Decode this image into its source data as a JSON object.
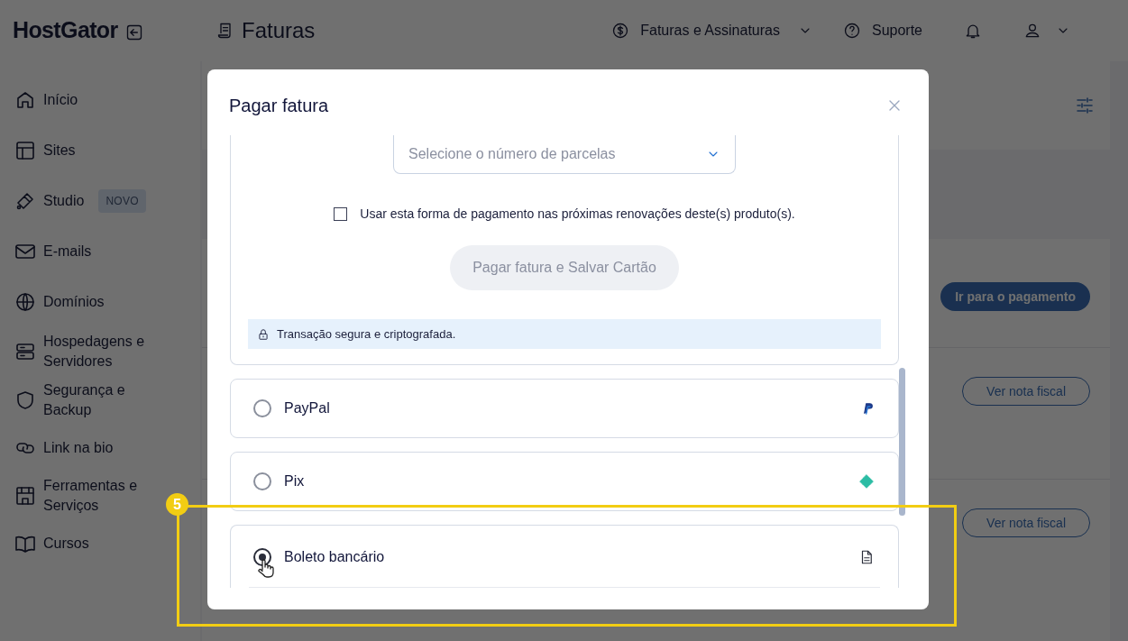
{
  "header": {
    "logo": "HostGator",
    "page_title": "Faturas",
    "nav": [
      {
        "kind": "billing",
        "label": "Faturas e Assinaturas"
      },
      {
        "kind": "support",
        "label": "Suporte"
      },
      {
        "kind": "bell"
      },
      {
        "kind": "user"
      }
    ]
  },
  "sidebar": {
    "items": [
      {
        "label": "Início"
      },
      {
        "label": "Sites"
      },
      {
        "label": "Studio",
        "badge": "NOVO"
      },
      {
        "label": "E-mails"
      },
      {
        "label": "Domínios"
      },
      {
        "label": "Hospedagens e Servidores"
      },
      {
        "label": "Segurança e Backup"
      },
      {
        "label": "Link na bio"
      },
      {
        "label": "Ferramentas e Serviços"
      },
      {
        "label": "Cursos"
      }
    ]
  },
  "background_rows": [
    {
      "button": "Ir para o pagamento",
      "kind": "primary"
    },
    {
      "button": "Ver nota fiscal",
      "kind": "outline"
    },
    {
      "button": "Ver nota fiscal",
      "kind": "outline"
    }
  ],
  "modal": {
    "title": "Pagar fatura",
    "card_form": {
      "installments": {
        "placeholder": "Selecione o número de parcelas"
      },
      "save_option": {
        "label": "Usar esta forma de pagamento nas próximas renovações deste(s) produto(s).",
        "checked": false
      },
      "submit": {
        "label": "Pagar fatura e Salvar Cartão",
        "disabled": true
      },
      "security_note": "Transação segura e criptografada."
    },
    "methods": [
      {
        "kind": "paypal",
        "label": "PayPal",
        "selected": false
      },
      {
        "kind": "pix",
        "label": "Pix",
        "selected": false
      },
      {
        "kind": "boleto",
        "label": "Boleto bancário",
        "selected": true
      }
    ]
  },
  "annotation": {
    "number": "5"
  }
}
